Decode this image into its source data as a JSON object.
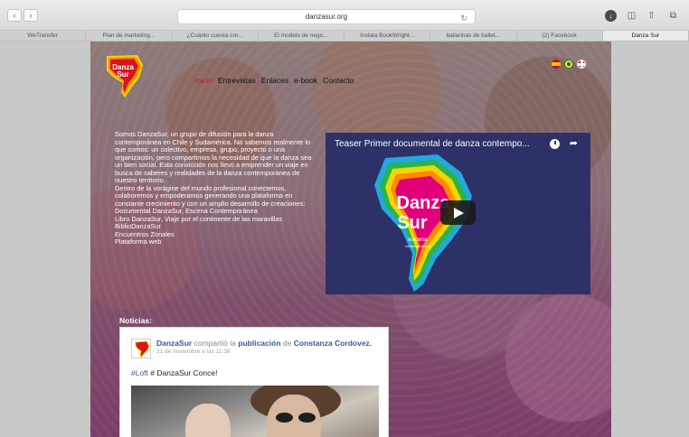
{
  "browser": {
    "url": "danzasur.org",
    "tabs": [
      {
        "label": "WeTransfer"
      },
      {
        "label": "Plan de marketing..."
      },
      {
        "label": "¿Cuánto cuesta cre..."
      },
      {
        "label": "El modelo de nego..."
      },
      {
        "label": "Instala BookWright..."
      },
      {
        "label": "bailarinas de ballet..."
      },
      {
        "label": "(2) Facebook"
      },
      {
        "label": "Danza Sur"
      }
    ],
    "active_tab": 7
  },
  "site": {
    "logo_text": "Danza Sur",
    "nav": [
      {
        "label": "Inicio"
      },
      {
        "label": "Entrevistas"
      },
      {
        "label": "Enlaces"
      },
      {
        "label": "e-book"
      },
      {
        "label": "Contacto"
      }
    ],
    "flags": [
      "spain-flag",
      "brazil-flag",
      "uk-flag"
    ],
    "intro": {
      "p1": "Somos DanzaSur, un grupo de difusión para la danza contemporánea en Chile y Sudamérica. No sabemos realmente lo que somos: un colectivo, empresa, grupo, proyecto o una organización, pero compartimos la necesidad de que la danza sea un bien social. Esta convicción nos llevó a emprender un viaje en busca de saberes y realidades de la danza contemporánea de nuestro territorio.",
      "p2": "Dentro de la vorágine del mundo profesional conectemos, colaboremos y empoderamos generando una plataforma en constante crecimiento y con un amplio desarrollo de creaciones:",
      "items": [
        "Documental DanzaSur, Escena Contemporánea",
        "Libro DanzaSur, Viaje por el continente de las maravillas",
        "BiblioDanzaSur",
        "Encuentros Zonales",
        "Plataforma web"
      ]
    },
    "video": {
      "title": "Teaser Primer documental de danza contempo...",
      "map_text_1": "Danza",
      "map_text_2": "Sur",
      "map_text_3": "escena",
      "map_text_4": "contemporánea"
    },
    "news": {
      "title": "Noticias:",
      "post": {
        "author": "DanzaSur",
        "action": "compartió la",
        "object": "publicación",
        "connector": "de",
        "target": "Constanza Cordovez.",
        "time": "21 de noviembre a las 11:38",
        "hashtag": "#Loft",
        "text": "# DanzaSur Conce!"
      }
    }
  }
}
